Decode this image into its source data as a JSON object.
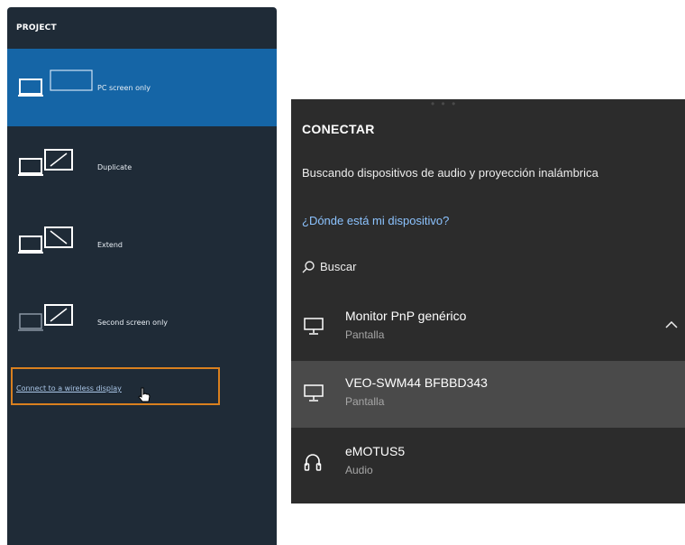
{
  "project": {
    "title": "PROJECT",
    "modes": [
      {
        "label": "PC screen only",
        "icon": "pc-screen-only-icon",
        "selected": true
      },
      {
        "label": "Duplicate",
        "icon": "duplicate-icon",
        "selected": false
      },
      {
        "label": "Extend",
        "icon": "extend-icon",
        "selected": false
      },
      {
        "label": "Second screen only",
        "icon": "second-screen-only-icon",
        "selected": false
      }
    ],
    "connect_link": "Connect to a wireless display"
  },
  "connect": {
    "title": "CONECTAR",
    "status": "Buscando dispositivos de audio y proyección inalámbrica",
    "help_link": "¿Dónde está mi dispositivo?",
    "search_label": "Buscar",
    "devices": [
      {
        "name": "Monitor PnP genérico",
        "type": "Pantalla",
        "icon": "monitor-icon"
      },
      {
        "name": "VEO-SWM44 BFBBD343",
        "type": "Pantalla",
        "icon": "monitor-icon"
      },
      {
        "name": "eMOTUS5",
        "type": "Audio",
        "icon": "headphones-icon"
      }
    ]
  },
  "colors": {
    "project_bg": "#1f2b37",
    "selected_bg": "#1565a6",
    "connect_bg": "#2c2c2c",
    "hover_bg": "#4a4a4a",
    "highlight_border": "#d9801f",
    "link": "#8cc3ff"
  }
}
